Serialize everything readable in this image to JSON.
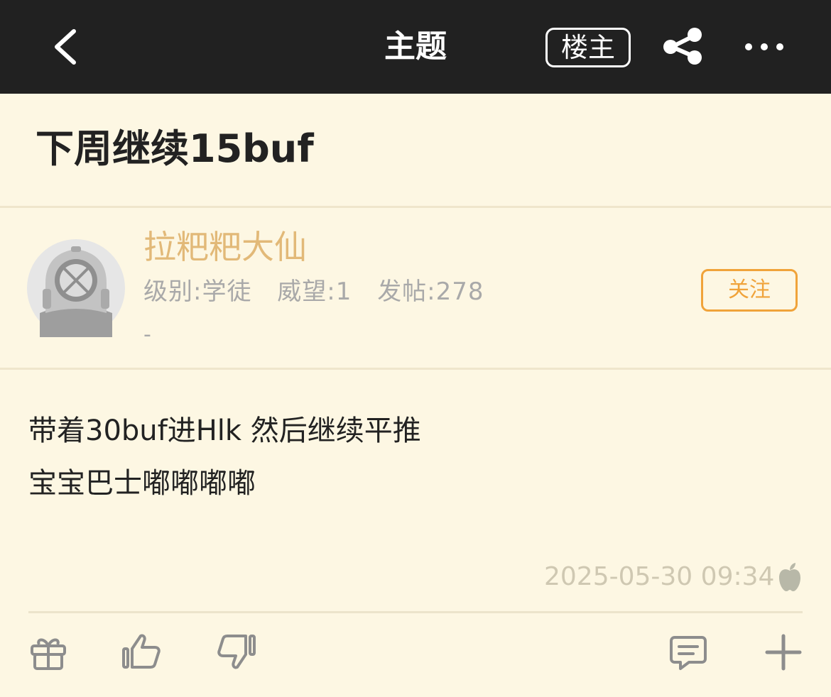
{
  "nav": {
    "title": "主题",
    "owner_label": "楼主"
  },
  "thread": {
    "title": "下周继续15buf"
  },
  "author": {
    "name": "拉粑粑大仙",
    "level": "级别:学徒",
    "reputation": "威望:1",
    "posts": "发帖:278",
    "signature": "-",
    "follow_label": "关注"
  },
  "post": {
    "lines": [
      "带着30buf进Hlk 然后继续平推",
      "宝宝巴士嘟嘟嘟嘟"
    ],
    "time": "2025-05-30 09:34",
    "device_icon": "apple-icon"
  },
  "actions": {
    "icons": [
      "gift-icon",
      "thumbs-up-icon",
      "thumbs-down-icon",
      "comment-icon",
      "plus-icon"
    ]
  },
  "colors": {
    "topbar": "#212121",
    "background": "#fdf7e3",
    "username": "#e2b978",
    "follow_accent": "#f0a33a"
  }
}
